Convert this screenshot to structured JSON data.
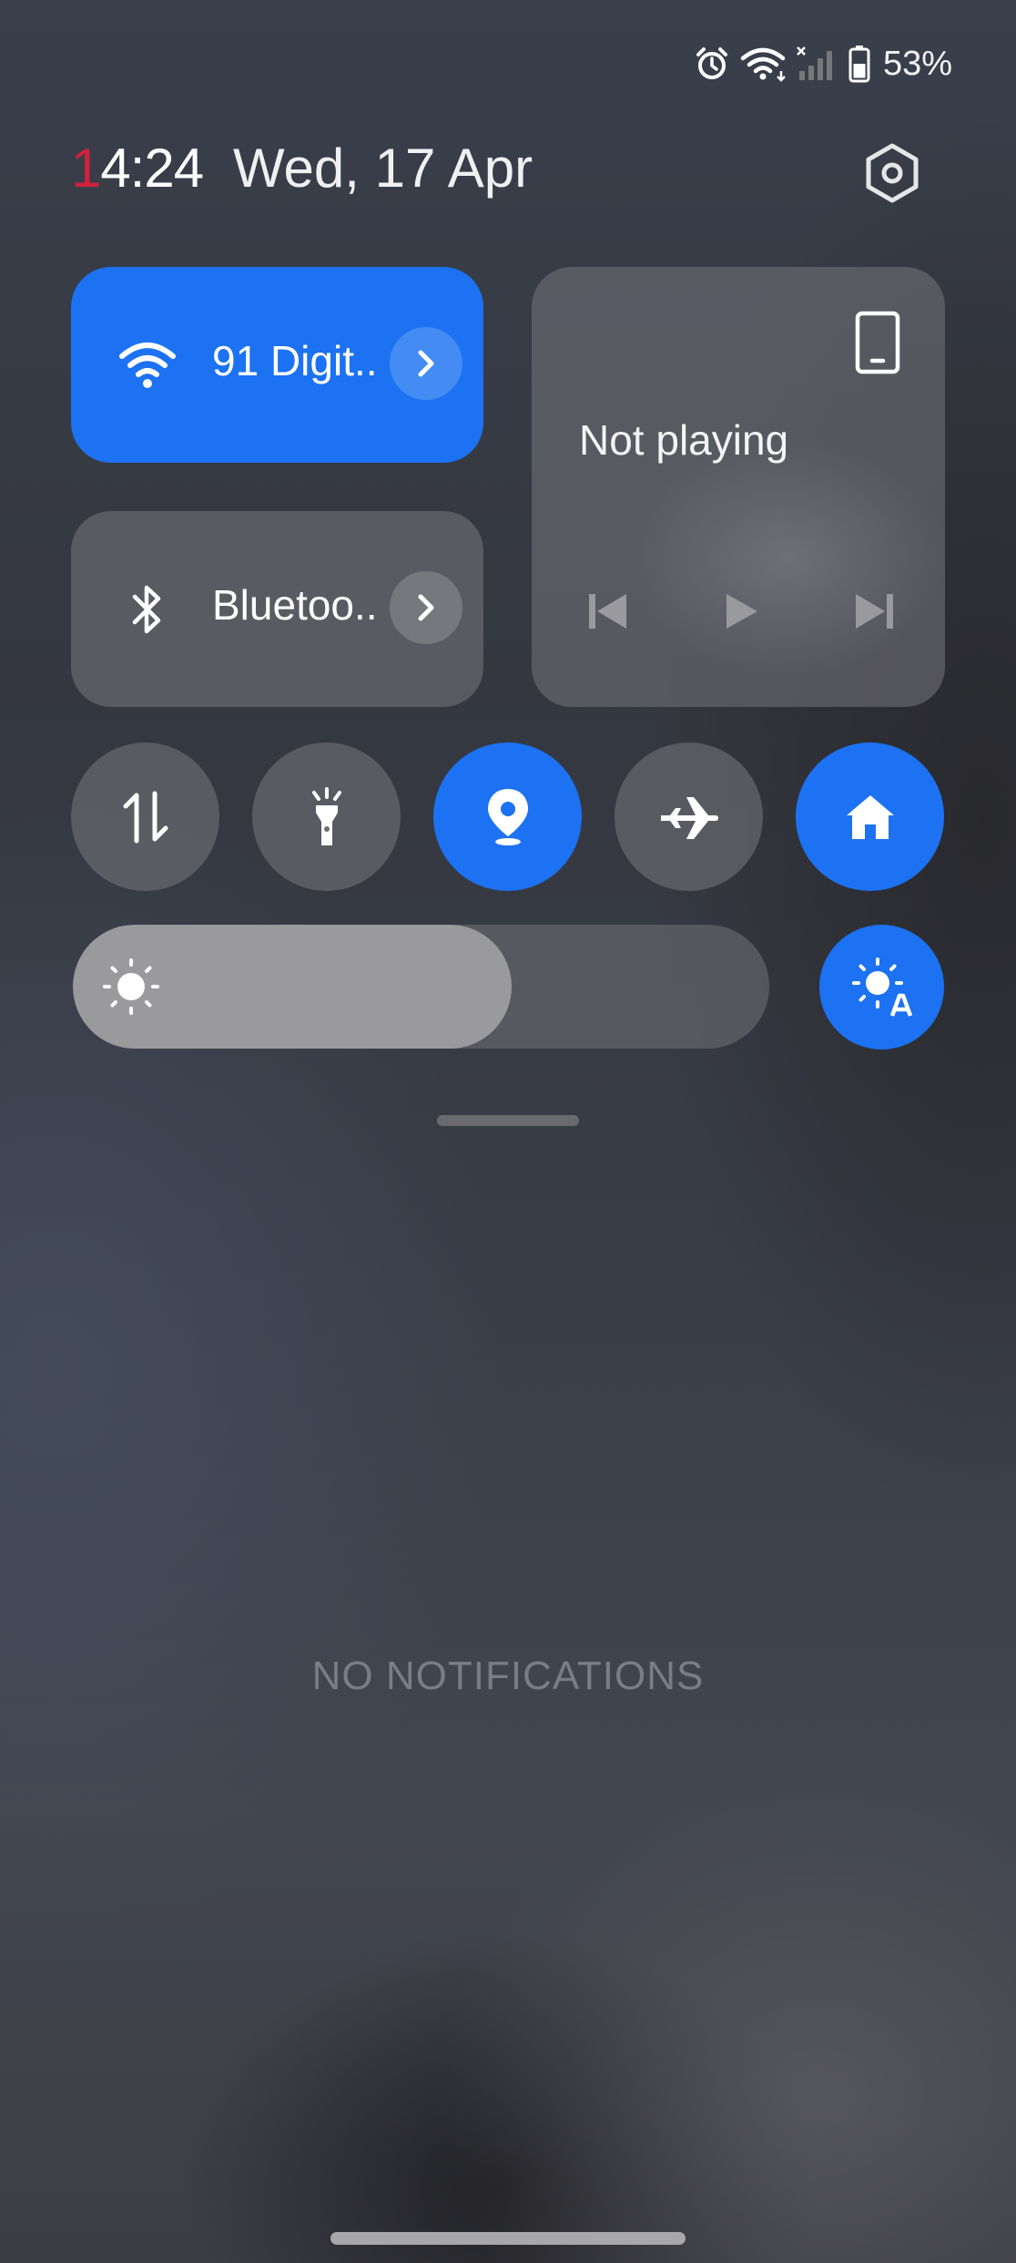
{
  "status_bar": {
    "icons": [
      "alarm-icon",
      "wifi-icon",
      "cell-signal-icon",
      "battery-icon"
    ],
    "battery_percent": "53%"
  },
  "header": {
    "time_first_digit": "1",
    "time_rest": "4:24",
    "date": "Wed, 17 Apr",
    "settings_icon": "gear-icon"
  },
  "tiles": {
    "wifi": {
      "label": "91 Digit..",
      "active": true
    },
    "bluetooth": {
      "label": "Bluetoo..",
      "active": false
    },
    "media": {
      "status": "Not playing"
    }
  },
  "toggles": [
    {
      "name": "mobile-data",
      "icon": "data-arrows-icon",
      "active": false
    },
    {
      "name": "flashlight",
      "icon": "flashlight-icon",
      "active": false
    },
    {
      "name": "location",
      "icon": "location-pin-icon",
      "active": true
    },
    {
      "name": "airplane-mode",
      "icon": "airplane-icon",
      "active": false
    },
    {
      "name": "home",
      "icon": "home-icon",
      "active": true
    }
  ],
  "brightness": {
    "level_percent": 63,
    "auto_enabled": true
  },
  "notifications": {
    "empty_text": "NO NOTIFICATIONS"
  },
  "colors": {
    "accent": "#1c72f2",
    "clock_accent": "#d0213e"
  }
}
